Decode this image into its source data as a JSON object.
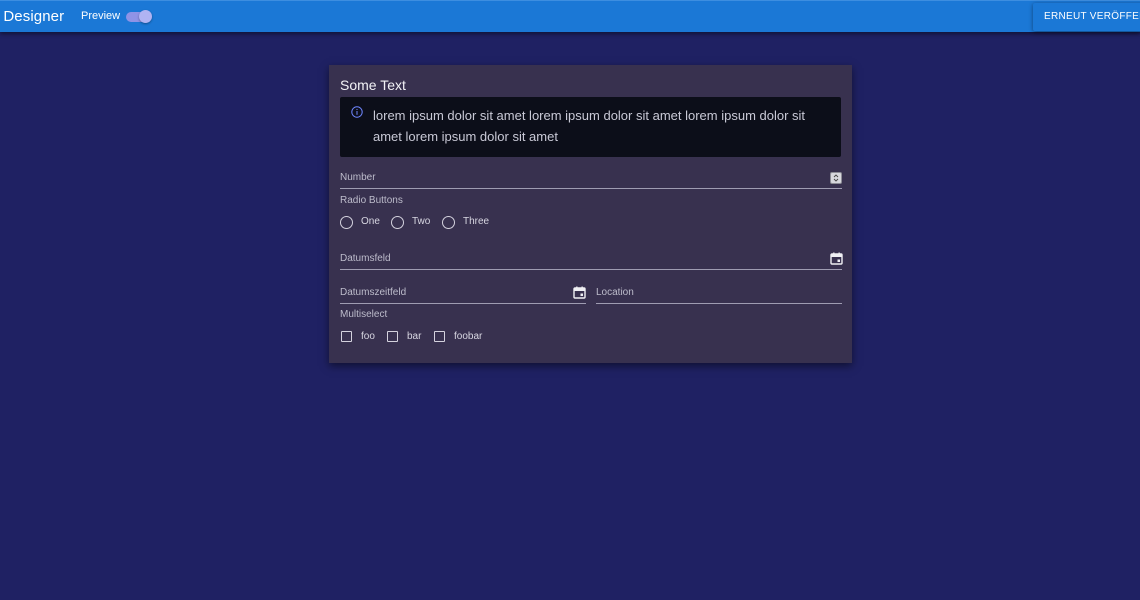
{
  "header": {
    "app_title": "r Designer",
    "preview_label": "Preview",
    "preview_enabled": true,
    "republish_label": "ERNEUT VERÖFFENTLICHEN"
  },
  "form": {
    "section_title": "Some Text",
    "info_text": "lorem ipsum dolor sit amet lorem ipsum dolor sit amet lorem ipsum dolor sit amet lorem ipsum dolor sit amet",
    "number_label": "Number",
    "radio_label": "Radio Buttons",
    "radio_options": [
      "One",
      "Two",
      "Three"
    ],
    "date_label": "Datumsfeld",
    "datetime_label": "Datumszeitfeld",
    "location_label": "Location",
    "multiselect_label": "Multiselect",
    "multiselect_options": [
      "foo",
      "bar",
      "foobar"
    ]
  },
  "colors": {
    "background": "#1f2163",
    "topbar": "#1b78d6",
    "card": "#38314f",
    "info_box": "#0c0e19",
    "toggle_on": "#8f93e6"
  },
  "icons": {
    "info": "info-circle-icon",
    "calendar": "calendar-icon",
    "stepper": "stepper-arrows-icon"
  }
}
